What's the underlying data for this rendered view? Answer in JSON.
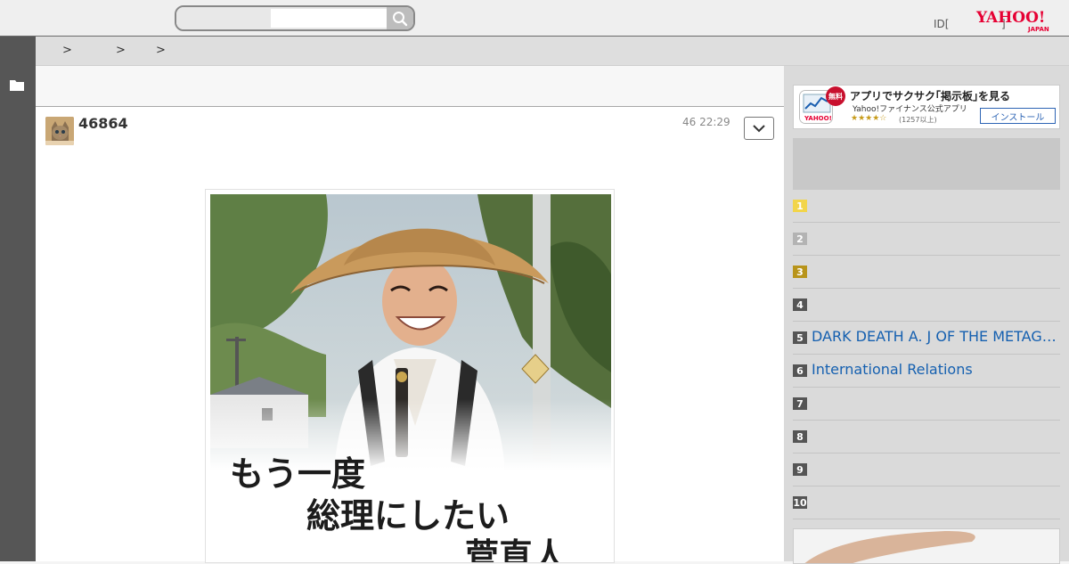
{
  "header": {
    "search_placeholder": "",
    "login_id": "ID[",
    "login_tail": "]",
    "logo_text": "YAHOO!",
    "logo_sub": "JAPAN"
  },
  "breadcrumbs": [
    ">",
    ">",
    ">"
  ],
  "post": {
    "count": "46864",
    "time": "46 22:29",
    "image_lines": [
      "もう一度",
      "総理にしたい",
      "菅直人"
    ]
  },
  "app_banner": {
    "badge": "無料",
    "title": "アプリでサクサク｢掲示板｣を見る",
    "subtitle": "Yahoo!ファイナンス公式アプリ",
    "stars": "★★★★☆",
    "reviews": "(1257以上)",
    "install_label": "インストール"
  },
  "ranking": [
    {
      "rank": "1",
      "title": "",
      "color": "#f2d54a"
    },
    {
      "rank": "2",
      "title": "",
      "color": "#b3b3b3"
    },
    {
      "rank": "3",
      "title": "",
      "color": "#b8941a"
    },
    {
      "rank": "4",
      "title": "",
      "color": "#555555"
    },
    {
      "rank": "5",
      "title": "DARK DEATH A. J OF THE METAGALAXY",
      "color": "#555555"
    },
    {
      "rank": "6",
      "title": "International Relations",
      "color": "#555555"
    },
    {
      "rank": "7",
      "title": "",
      "color": "#555555"
    },
    {
      "rank": "8",
      "title": "",
      "color": "#555555"
    },
    {
      "rank": "9",
      "title": "",
      "color": "#555555"
    },
    {
      "rank": "10",
      "title": "",
      "color": "#555555"
    }
  ],
  "colors": {
    "link": "#1560b0",
    "rail": "#565656",
    "logo_red": "#e60033"
  }
}
